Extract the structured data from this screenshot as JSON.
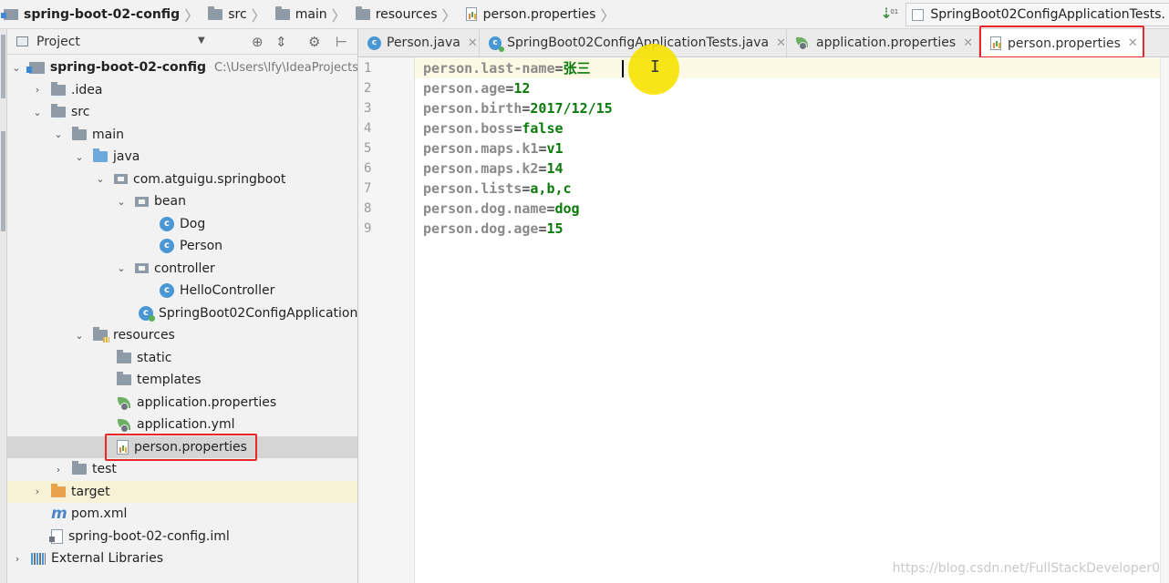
{
  "breadcrumb": {
    "items": [
      {
        "label": "spring-boot-02-config",
        "icon": "module-icon"
      },
      {
        "label": "src",
        "icon": "folder-icon"
      },
      {
        "label": "main",
        "icon": "folder-icon"
      },
      {
        "label": "resources",
        "icon": "resources-folder-icon"
      },
      {
        "label": "person.properties",
        "icon": "properties-file-icon"
      }
    ],
    "run_config": "SpringBoot02ConfigApplicationTests."
  },
  "project_panel": {
    "title": "Project",
    "tree": [
      {
        "label": "spring-boot-02-config",
        "path": "C:\\Users\\lfy\\IdeaProjects",
        "icon": "module-icon"
      },
      {
        "label": ".idea",
        "icon": "folder-icon"
      },
      {
        "label": "src",
        "icon": "folder-icon"
      },
      {
        "label": "main",
        "icon": "folder-icon"
      },
      {
        "label": "java",
        "icon": "source-folder-icon"
      },
      {
        "label": "com.atguigu.springboot",
        "icon": "package-icon"
      },
      {
        "label": "bean",
        "icon": "package-icon"
      },
      {
        "label": "Dog",
        "icon": "class-icon"
      },
      {
        "label": "Person",
        "icon": "class-icon"
      },
      {
        "label": "controller",
        "icon": "package-icon"
      },
      {
        "label": "HelloController",
        "icon": "class-icon"
      },
      {
        "label": "SpringBoot02ConfigApplication",
        "icon": "spring-boot-app-icon"
      },
      {
        "label": "resources",
        "icon": "resources-folder-icon"
      },
      {
        "label": "static",
        "icon": "folder-icon"
      },
      {
        "label": "templates",
        "icon": "folder-icon"
      },
      {
        "label": "application.properties",
        "icon": "spring-config-icon"
      },
      {
        "label": "application.yml",
        "icon": "spring-config-icon"
      },
      {
        "label": "person.properties",
        "icon": "properties-file-icon"
      },
      {
        "label": "test",
        "icon": "folder-icon"
      },
      {
        "label": "target",
        "icon": "excluded-folder-icon"
      },
      {
        "label": "pom.xml",
        "icon": "maven-icon"
      },
      {
        "label": "spring-boot-02-config.iml",
        "icon": "iml-file-icon"
      },
      {
        "label": "External Libraries",
        "icon": "library-icon"
      }
    ]
  },
  "tabs": [
    {
      "label": "Person.java",
      "icon": "class-icon"
    },
    {
      "label": "SpringBoot02ConfigApplicationTests.java",
      "icon": "test-class-icon"
    },
    {
      "label": "application.properties",
      "icon": "spring-config-icon"
    },
    {
      "label": "person.properties",
      "icon": "properties-file-icon",
      "active": true
    }
  ],
  "editor": {
    "line_numbers": [
      "1",
      "2",
      "3",
      "4",
      "5",
      "6",
      "7",
      "8",
      "9"
    ],
    "lines": [
      {
        "key": "person.last-name",
        "value": "张三"
      },
      {
        "key": "person.age",
        "value": "12"
      },
      {
        "key": "person.birth",
        "value": "2017/12/15"
      },
      {
        "key": "person.boss",
        "value": "false"
      },
      {
        "key": "person.maps.k1",
        "value": "v1"
      },
      {
        "key": "person.maps.k2",
        "value": "14"
      },
      {
        "key": "person.lists",
        "value": "a,b,c"
      },
      {
        "key": "person.dog.name",
        "value": "dog"
      },
      {
        "key": "person.dog.age",
        "value": "15"
      }
    ],
    "equals": "="
  },
  "watermark": "https://blog.csdn.net/FullStackDeveloper0",
  "colors": {
    "highlight_box": "#e6282a",
    "cursor_halo": "#f6e200",
    "property_value": "#0a7a0a"
  }
}
